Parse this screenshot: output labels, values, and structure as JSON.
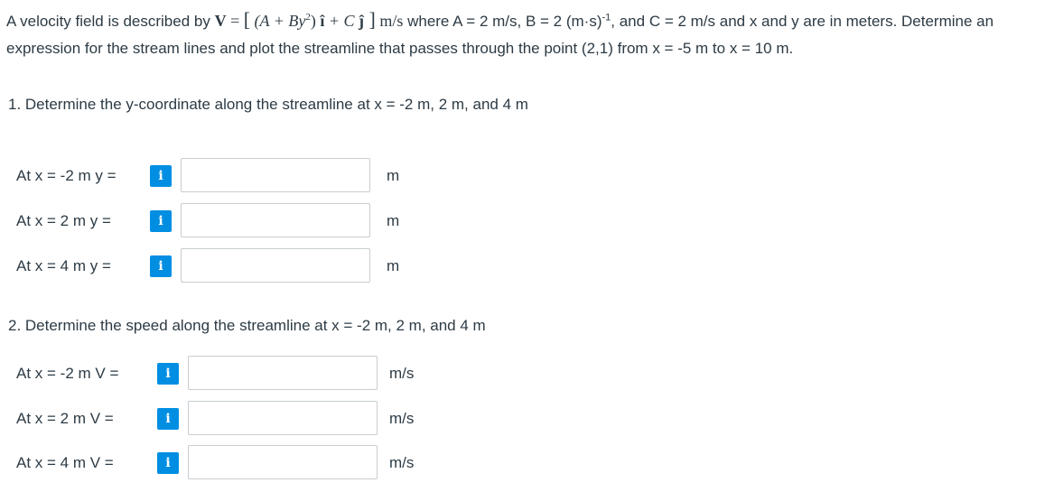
{
  "problem": {
    "intro": "A velocity field is described by ",
    "eq_V": "V",
    "eq_eq": " = ",
    "eq_open": "[",
    "eq_inner": " (A + By",
    "eq_sq": "2",
    "eq_after": ") ",
    "eq_i": "î",
    "eq_plus": " + C ",
    "eq_j": "ĵ",
    "eq_close": " ]",
    "eq_units": " m/s",
    "given_1": " where A = 2 m/s, B = 2 (m·s)",
    "given_exp": "-1",
    "given_2": ", and C = 2 m/s and x and y are in meters. Determine an expression for the stream lines and plot the streamline that passes through the point (2,1) from x = -5 m to x = 10 m."
  },
  "question1": {
    "text": "1. Determine the y-coordinate along the streamline at x = -2 m, 2 m, and 4 m",
    "rows": [
      {
        "label": "At x = -2 m y =",
        "info": "i",
        "value": "",
        "unit": "m"
      },
      {
        "label": "At x = 2 m y =",
        "info": "i",
        "value": "",
        "unit": "m"
      },
      {
        "label": "At x = 4 m y =",
        "info": "i",
        "value": "",
        "unit": "m"
      }
    ]
  },
  "question2": {
    "text": "2. Determine the speed along the streamline at x = -2 m, 2 m, and 4 m",
    "rows": [
      {
        "label": "At x = -2 m V =",
        "info": "i",
        "value": "",
        "unit": "m/s"
      },
      {
        "label": "At x = 2 m V =",
        "info": "i",
        "value": "",
        "unit": "m/s"
      },
      {
        "label": "At x = 4 m V =",
        "info": "i",
        "value": "",
        "unit": "m/s"
      }
    ]
  },
  "colors": {
    "info_button": "#008ee2",
    "text": "#2d3b45",
    "field_border": "#c7cdd1"
  }
}
